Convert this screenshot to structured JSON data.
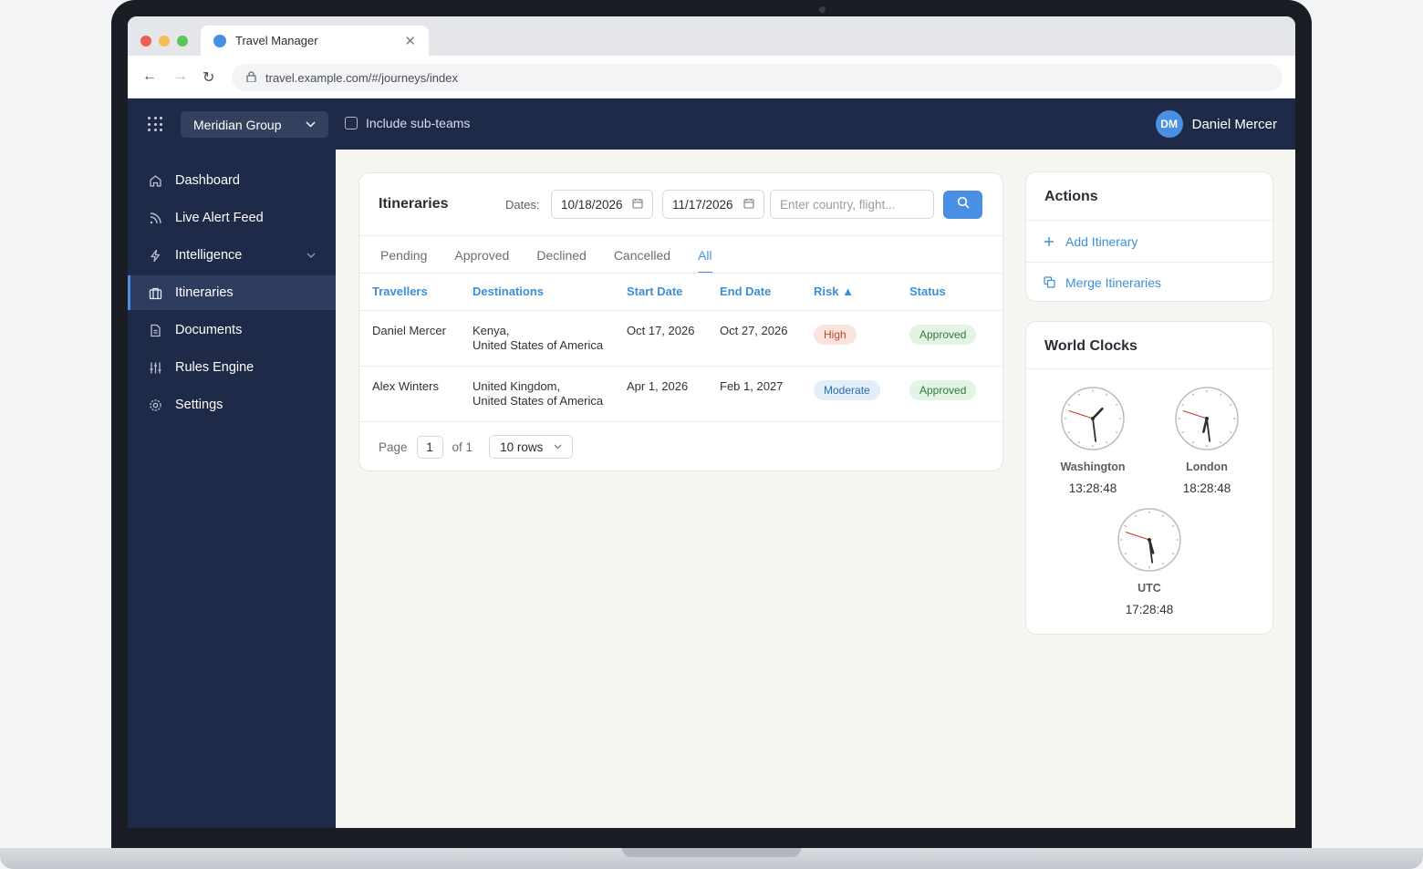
{
  "browser": {
    "tab_title": "Travel Manager",
    "url": "travel.example.com/#/journeys/index"
  },
  "header": {
    "org": "Meridian Group",
    "include_subteams_label": "Include sub-teams",
    "include_subteams_checked": false,
    "user_initials": "DM",
    "user_name": "Daniel Mercer"
  },
  "sidebar": {
    "items": [
      {
        "label": "Dashboard",
        "icon": "home-icon"
      },
      {
        "label": "Live Alert Feed",
        "icon": "rss-icon"
      },
      {
        "label": "Intelligence",
        "icon": "bolt-icon"
      },
      {
        "label": "Itineraries",
        "icon": "briefcase-icon"
      },
      {
        "label": "Documents",
        "icon": "document-icon"
      },
      {
        "label": "Rules Engine",
        "icon": "sliders-icon"
      },
      {
        "label": "Settings",
        "icon": "gear-icon"
      }
    ],
    "active": "Itineraries"
  },
  "itineraries": {
    "title": "Itineraries",
    "dates_label": "Dates:",
    "date_from": "10/18/2026",
    "date_to": "11/17/2026",
    "search_placeholder": "Enter country, flight...",
    "tabs": [
      "Pending",
      "Approved",
      "Declined",
      "Cancelled",
      "All"
    ],
    "active_tab": "All",
    "columns": [
      "Travellers",
      "Destinations",
      "Start Date",
      "End Date",
      "Risk ▲",
      "Status"
    ],
    "rows": [
      {
        "traveller": "Daniel Mercer",
        "dest1": "Kenya,",
        "dest2": "United States of America",
        "start": "Oct 17, 2026",
        "end": "Oct 27, 2026",
        "risk": "High",
        "status": "Approved"
      },
      {
        "traveller": "Alex Winters",
        "dest1": "United Kingdom,",
        "dest2": "United States of America",
        "start": "Apr 1, 2026",
        "end": "Feb 1, 2027",
        "risk": "Moderate",
        "status": "Approved"
      }
    ],
    "pager": {
      "page_label": "Page",
      "page": "1",
      "of_label": "of 1",
      "rows_label": "10 rows"
    }
  },
  "actions": {
    "title": "Actions",
    "items": [
      {
        "label": "Add Itinerary",
        "icon": "plus-icon"
      },
      {
        "label": "Merge Itineraries",
        "icon": "copy-icon"
      }
    ]
  },
  "world_clocks": {
    "title": "World Clocks",
    "clocks": [
      {
        "city": "Washington",
        "time": "13:28:48"
      },
      {
        "city": "London",
        "time": "18:28:48"
      },
      {
        "city": "UTC",
        "time": "17:28:48"
      }
    ]
  },
  "colors": {
    "accent": "#4a90e2",
    "nav_bg": "#1e2a47",
    "risk_high": "#c2452b",
    "risk_moderate": "#2b6cb0",
    "status_approved": "#2f7d38"
  }
}
